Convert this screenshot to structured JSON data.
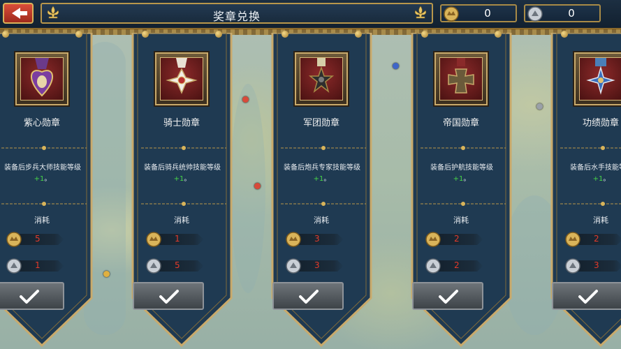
{
  "header": {
    "title": "奖章兑换",
    "gold_count": "0",
    "silver_count": "0"
  },
  "medals": [
    {
      "name": "紫心勋章",
      "desc_prefix": "装备后步兵大师技能等级",
      "bonus": "+1",
      "desc_suffix": "。",
      "cost_label": "消耗",
      "gold_cost": "5",
      "silver_cost": "1"
    },
    {
      "name": "骑士勋章",
      "desc_prefix": "装备后骑兵统帅技能等级",
      "bonus": "+1",
      "desc_suffix": "。",
      "cost_label": "消耗",
      "gold_cost": "1",
      "silver_cost": "5"
    },
    {
      "name": "军团勋章",
      "desc_prefix": "装备后炮兵专家技能等级",
      "bonus": "+1",
      "desc_suffix": "。",
      "cost_label": "消耗",
      "gold_cost": "3",
      "silver_cost": "3"
    },
    {
      "name": "帝国勋章",
      "desc_prefix": "装备后护航技能等级",
      "bonus": "+1",
      "desc_suffix": "。",
      "cost_label": "消耗",
      "gold_cost": "2",
      "silver_cost": "2"
    },
    {
      "name": "功绩勋章",
      "desc_prefix": "装备后水手技能等级",
      "bonus": "+1",
      "desc_suffix": "。",
      "cost_label": "消耗",
      "gold_cost": "2",
      "silver_cost": "3"
    }
  ],
  "colors": {
    "banner": "#1f3a52",
    "gold_trim": "#b9974b",
    "cost_red": "#e33a2a",
    "bonus_green": "#47d447"
  },
  "icons": {
    "back": "back-arrow-icon",
    "gold": "gold-medal-coin-icon",
    "silver": "silver-medal-coin-icon",
    "confirm": "checkmark-icon"
  }
}
